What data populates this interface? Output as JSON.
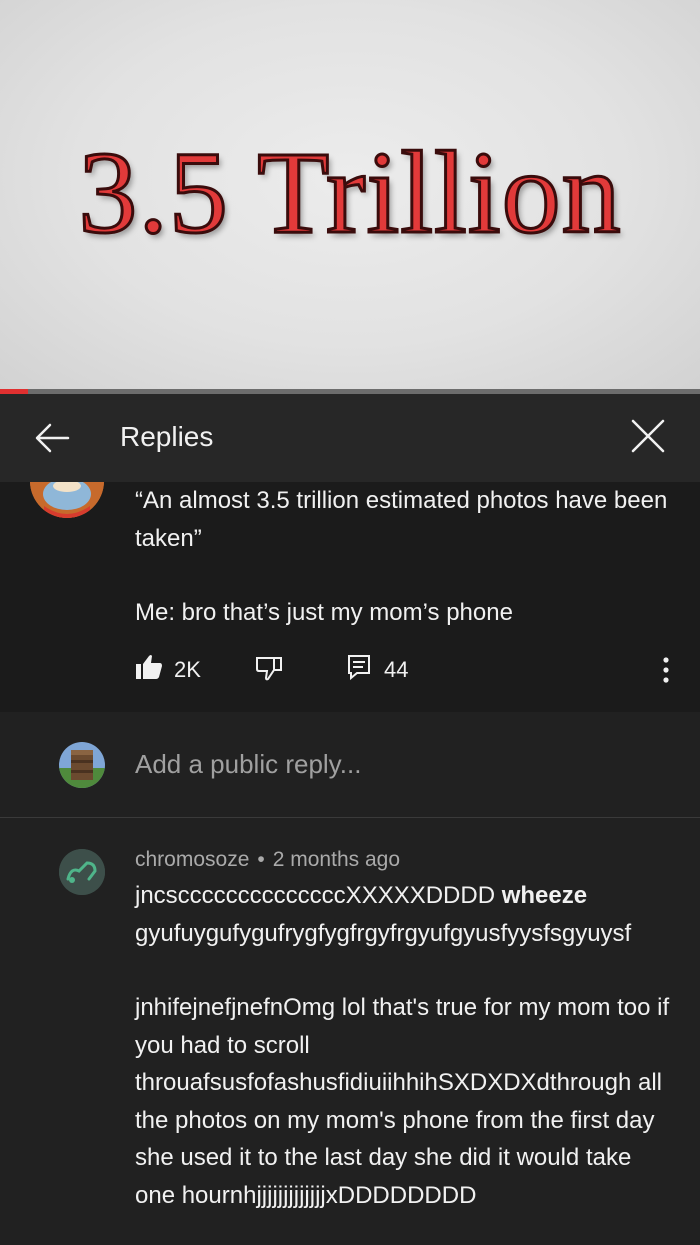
{
  "video": {
    "overlay_title": "3.5 Trillion",
    "progress": 0.04,
    "accent_color": "#e03030"
  },
  "panel": {
    "title": "Replies",
    "back_icon": "arrow-left-icon",
    "close_icon": "close-icon"
  },
  "comment": {
    "line1": "“An almost 3.5 trillion estimated photos have been taken”",
    "line2": "Me: bro that’s just my mom’s phone",
    "likes": "2K",
    "replies_count": "44",
    "like_icon": "thumbs-up-filled-icon",
    "dislike_icon": "thumbs-down-icon",
    "replies_icon": "comment-icon",
    "more_icon": "more-vertical-icon"
  },
  "reply_box": {
    "placeholder": "Add a public reply..."
  },
  "reply": {
    "author": "chromosoze",
    "separator": "•",
    "time": "2 months ago",
    "p1_text": "jncsccccccccccccccXXXXXDDDD ",
    "p1_bold": "wheeze",
    "p1_rest": " gyufuygufygufrygfygfrgyfrgyufgyusfyysfsgyuysf",
    "p2": "jnhifejnefjnefnOmg lol that's true for my mom too if you had to scroll throuafsusfofashusfidiuiihhihSXDXDXdthrough all the photos on my mom's phone from the first day she used it to the last day she did it would take one hournhjjjjjjjjjjjjjxDDDDDDDD"
  }
}
